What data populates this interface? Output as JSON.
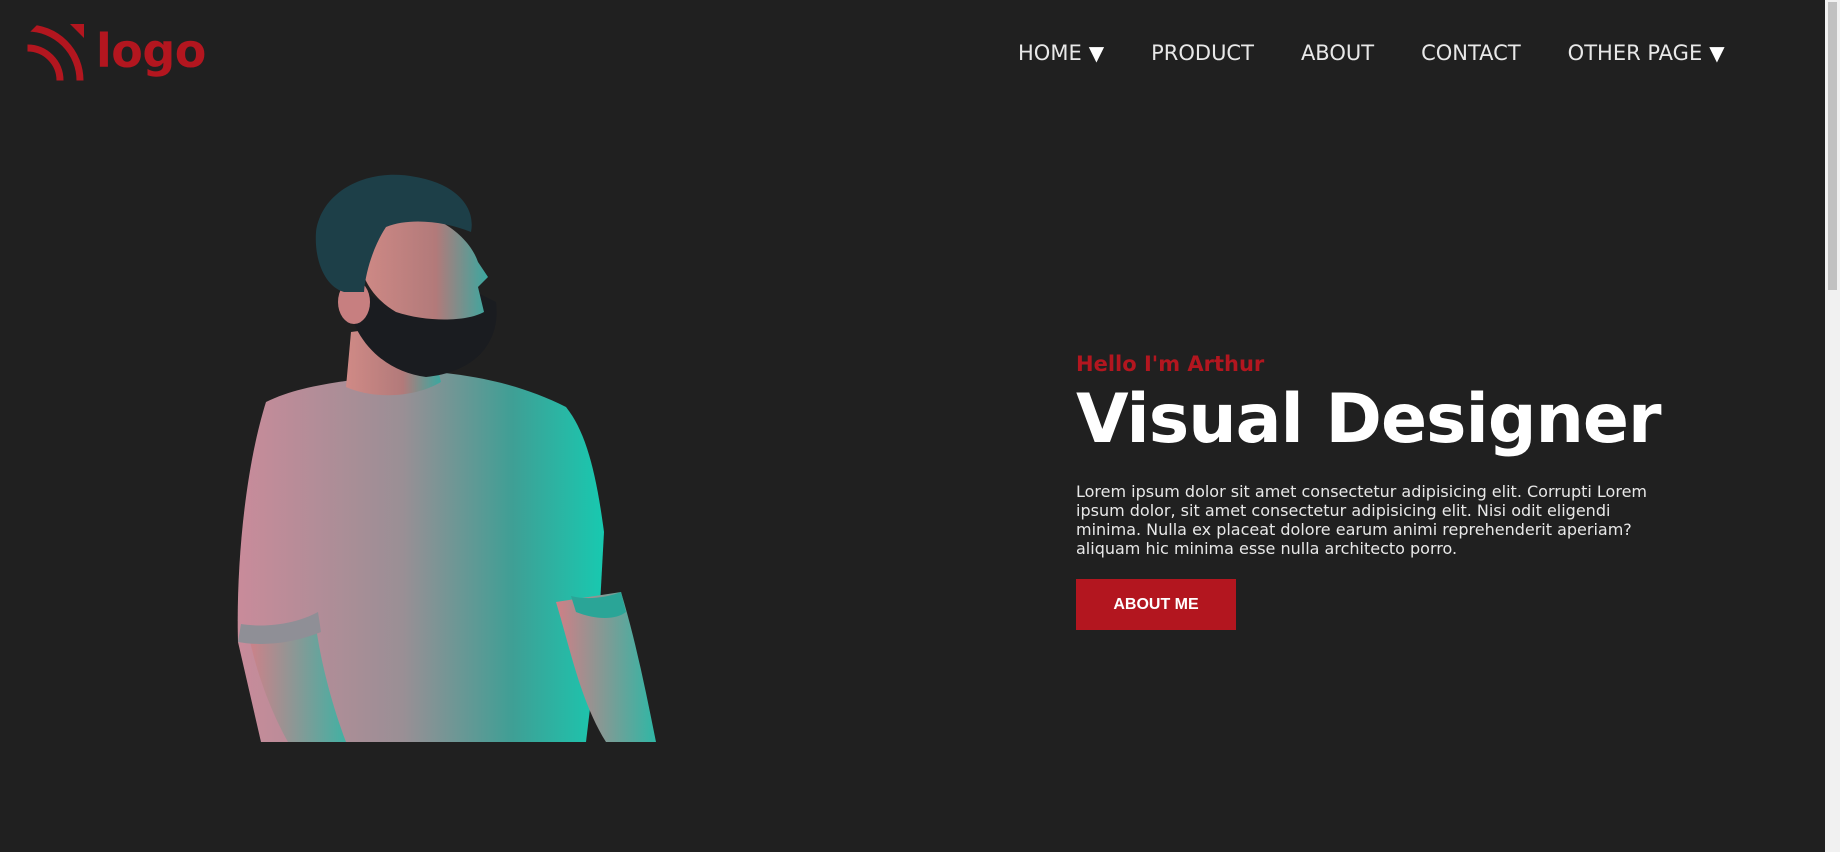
{
  "header": {
    "logo_text": "logo",
    "nav": [
      {
        "label": "HOME",
        "has_caret": true
      },
      {
        "label": "PRODUCT",
        "has_caret": false
      },
      {
        "label": "ABOUT",
        "has_caret": false
      },
      {
        "label": "CONTACT",
        "has_caret": false
      },
      {
        "label": "OTHER PAGE",
        "has_caret": true
      }
    ],
    "caret": "▼"
  },
  "hero": {
    "greeting": "Hello I'm Arthur",
    "title": "Visual Designer",
    "description": "Lorem ipsum dolor sit amet consectetur adipisicing elit. Corrupti Lorem ipsum dolor, sit amet consectetur adipisicing elit. Nisi odit eligendi minima. Nulla ex placeat dolore earum animi reprehenderit aperiam? aliquam hic minima esse nulla architecto porro.",
    "cta_label": "ABOUT ME"
  },
  "colors": {
    "background": "#202020",
    "accent": "#b3161f",
    "text": "#ffffff"
  },
  "icons": {
    "logo": "signal-arcs-icon",
    "caret": "caret-down-icon"
  }
}
